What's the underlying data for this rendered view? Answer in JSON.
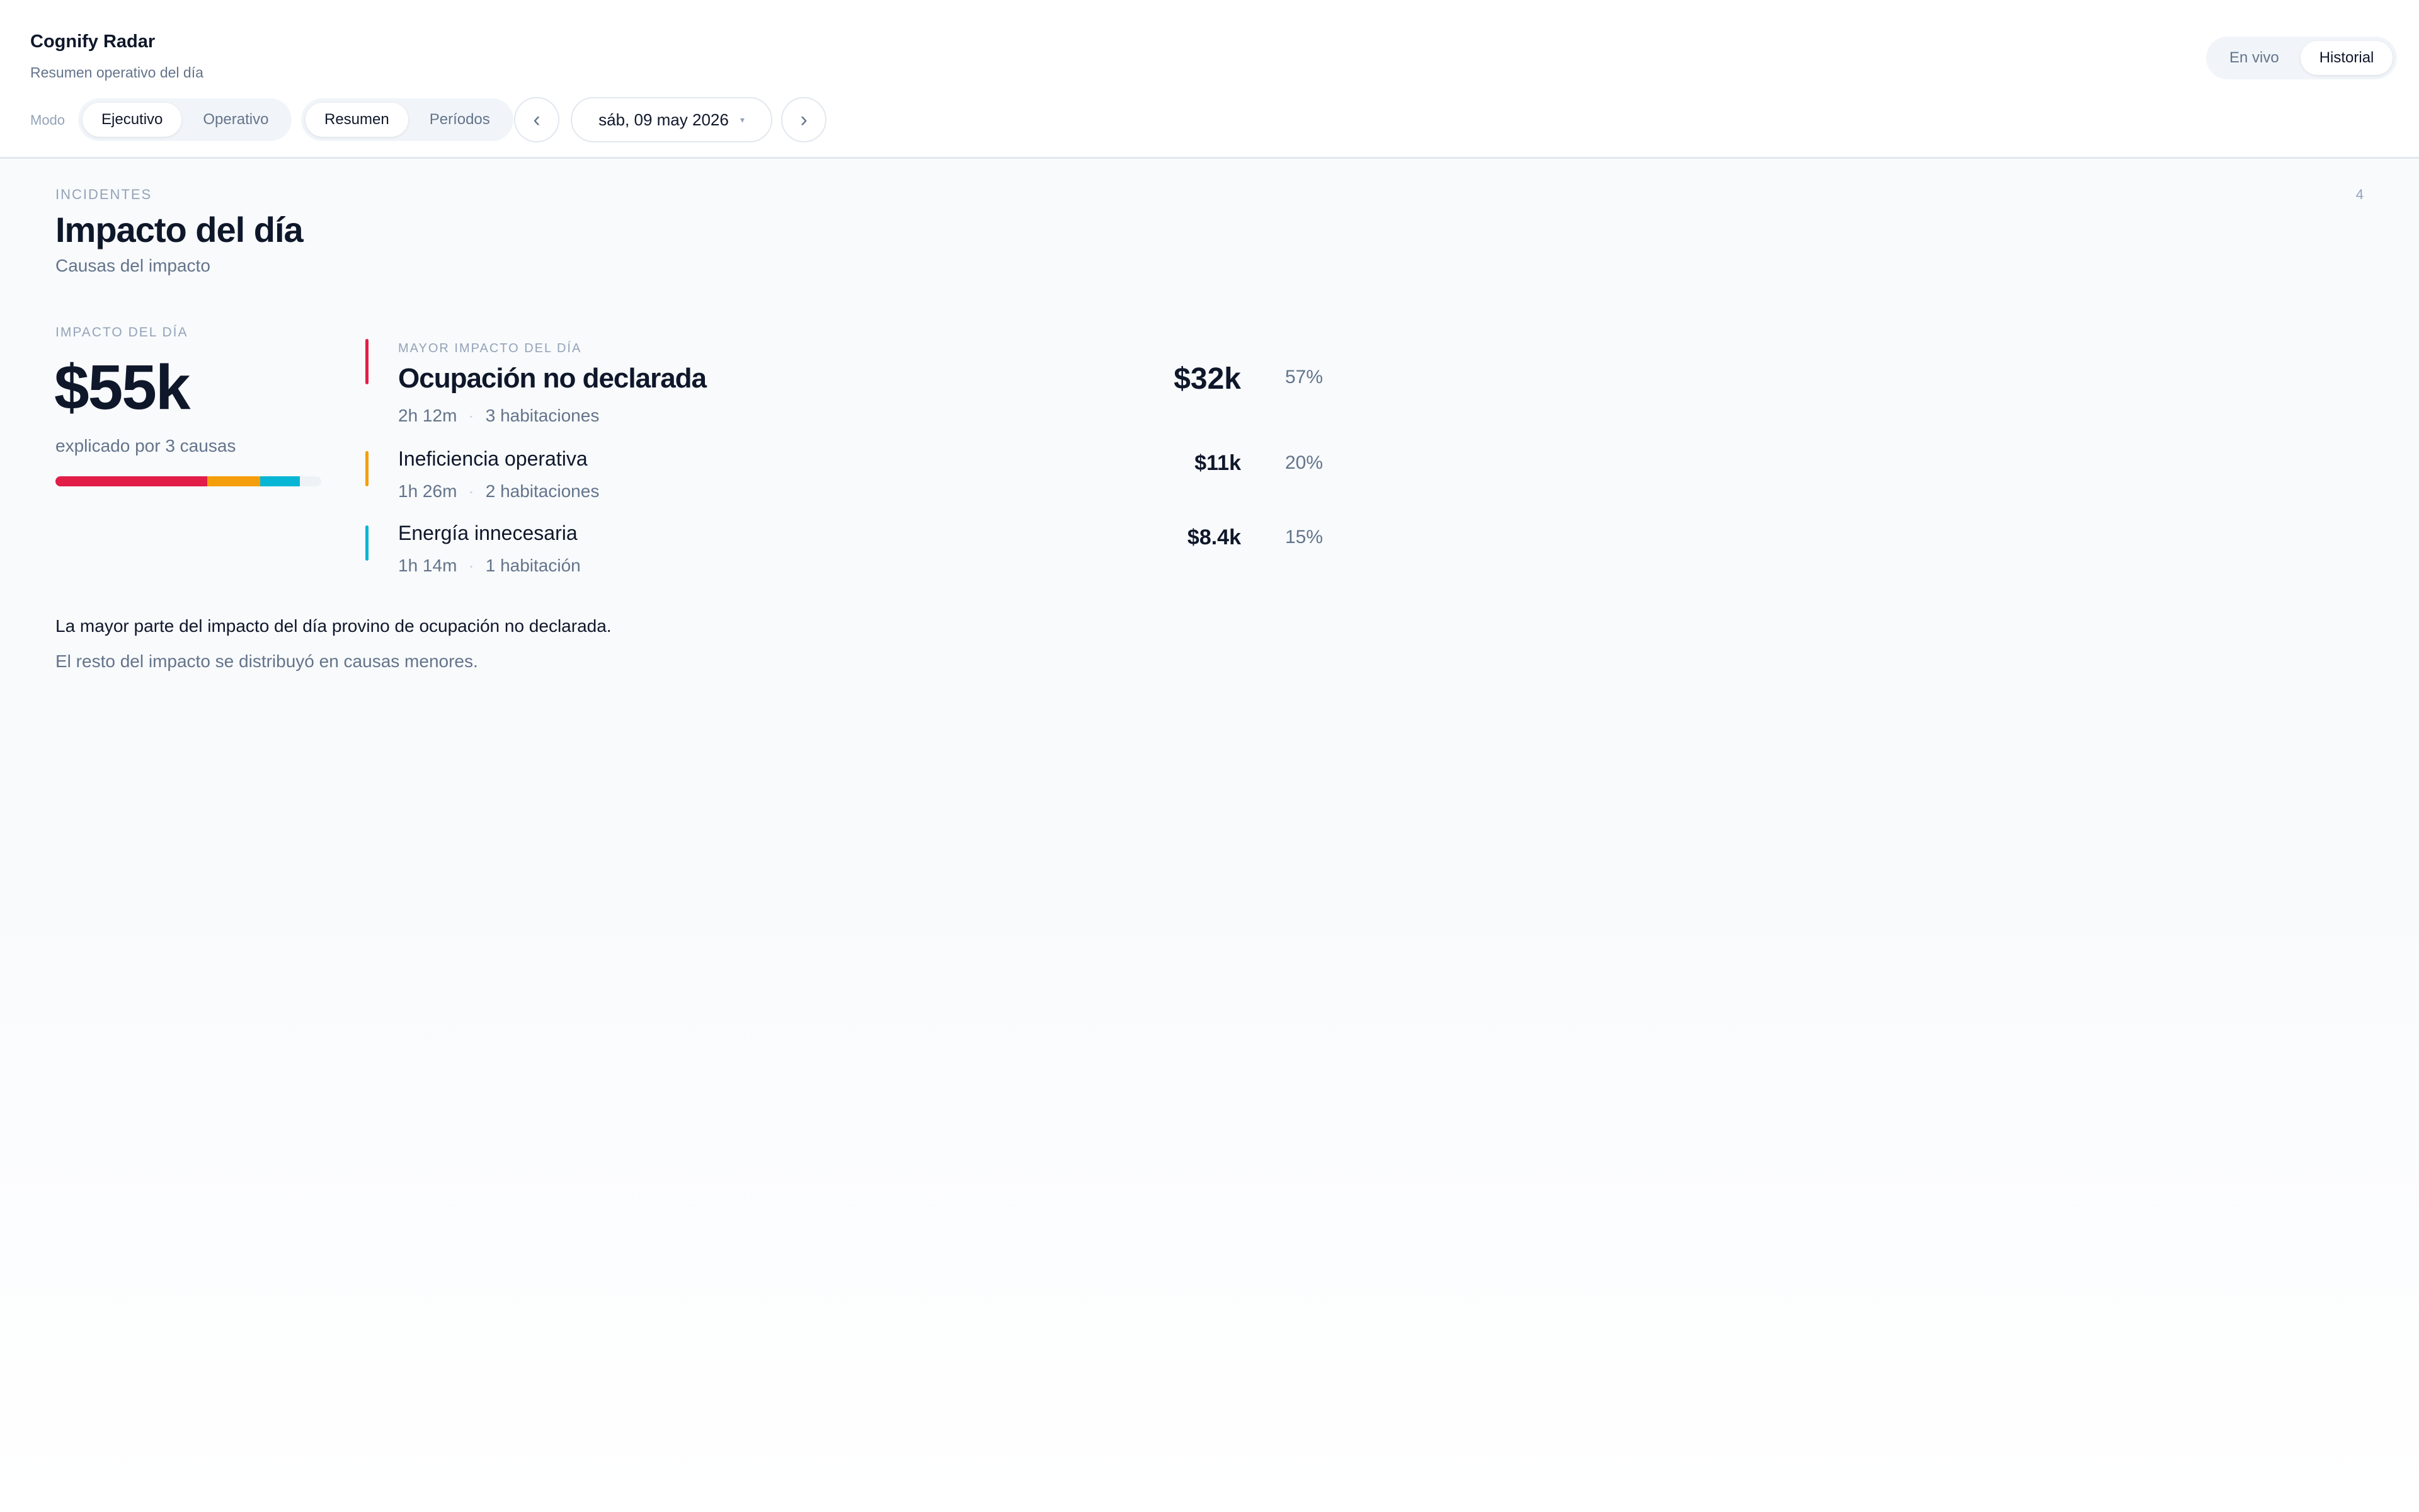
{
  "app": {
    "title": "Cognify Radar",
    "subtitle": "Resumen operativo del día"
  },
  "toolbar": {
    "mode_label": "Modo",
    "mode_options": [
      "Ejecutivo",
      "Operativo"
    ],
    "mode_selected": "Ejecutivo",
    "view_options": [
      "Resumen",
      "Períodos"
    ],
    "view_selected": "Resumen",
    "prev_glyph": "‹",
    "next_glyph": "›",
    "date": "sáb, 09 may 2026",
    "date_caret": "▾",
    "live_options": [
      "En vivo",
      "Historial"
    ],
    "live_selected": "Historial"
  },
  "section": {
    "kicker": "INCIDENTES",
    "count": "4",
    "title": "Impacto del día",
    "subtitle": "Causas del impacto"
  },
  "total": {
    "kicker": "IMPACTO DEL DÍA",
    "value": "$55k",
    "explained": "explicado por 3 causas"
  },
  "causes": [
    {
      "kicker": "MAYOR IMPACTO DEL DÍA",
      "name": "Ocupación no declarada",
      "duration": "2h 12m",
      "rooms": "3 habitaciones",
      "amount": "$32k",
      "percent": "57%",
      "share": 57,
      "color": "#e11d48"
    },
    {
      "name": "Ineficiencia operativa",
      "duration": "1h 26m",
      "rooms": "2 habitaciones",
      "amount": "$11k",
      "percent": "20%",
      "share": 20,
      "color": "#f59e0b"
    },
    {
      "name": "Energía innecesaria",
      "duration": "1h 14m",
      "rooms": "1 habitación",
      "amount": "$8.4k",
      "percent": "15%",
      "share": 15,
      "color": "#06b6d4"
    }
  ],
  "insight": {
    "main": "La mayor parte del impacto del día provino de ocupación no declarada.",
    "sub": "El resto del impacto se distribuyó en causas menores."
  },
  "icons": {
    "prev": "chevron-left-icon",
    "next": "chevron-right-icon",
    "date_caret": "caret-down-icon"
  }
}
